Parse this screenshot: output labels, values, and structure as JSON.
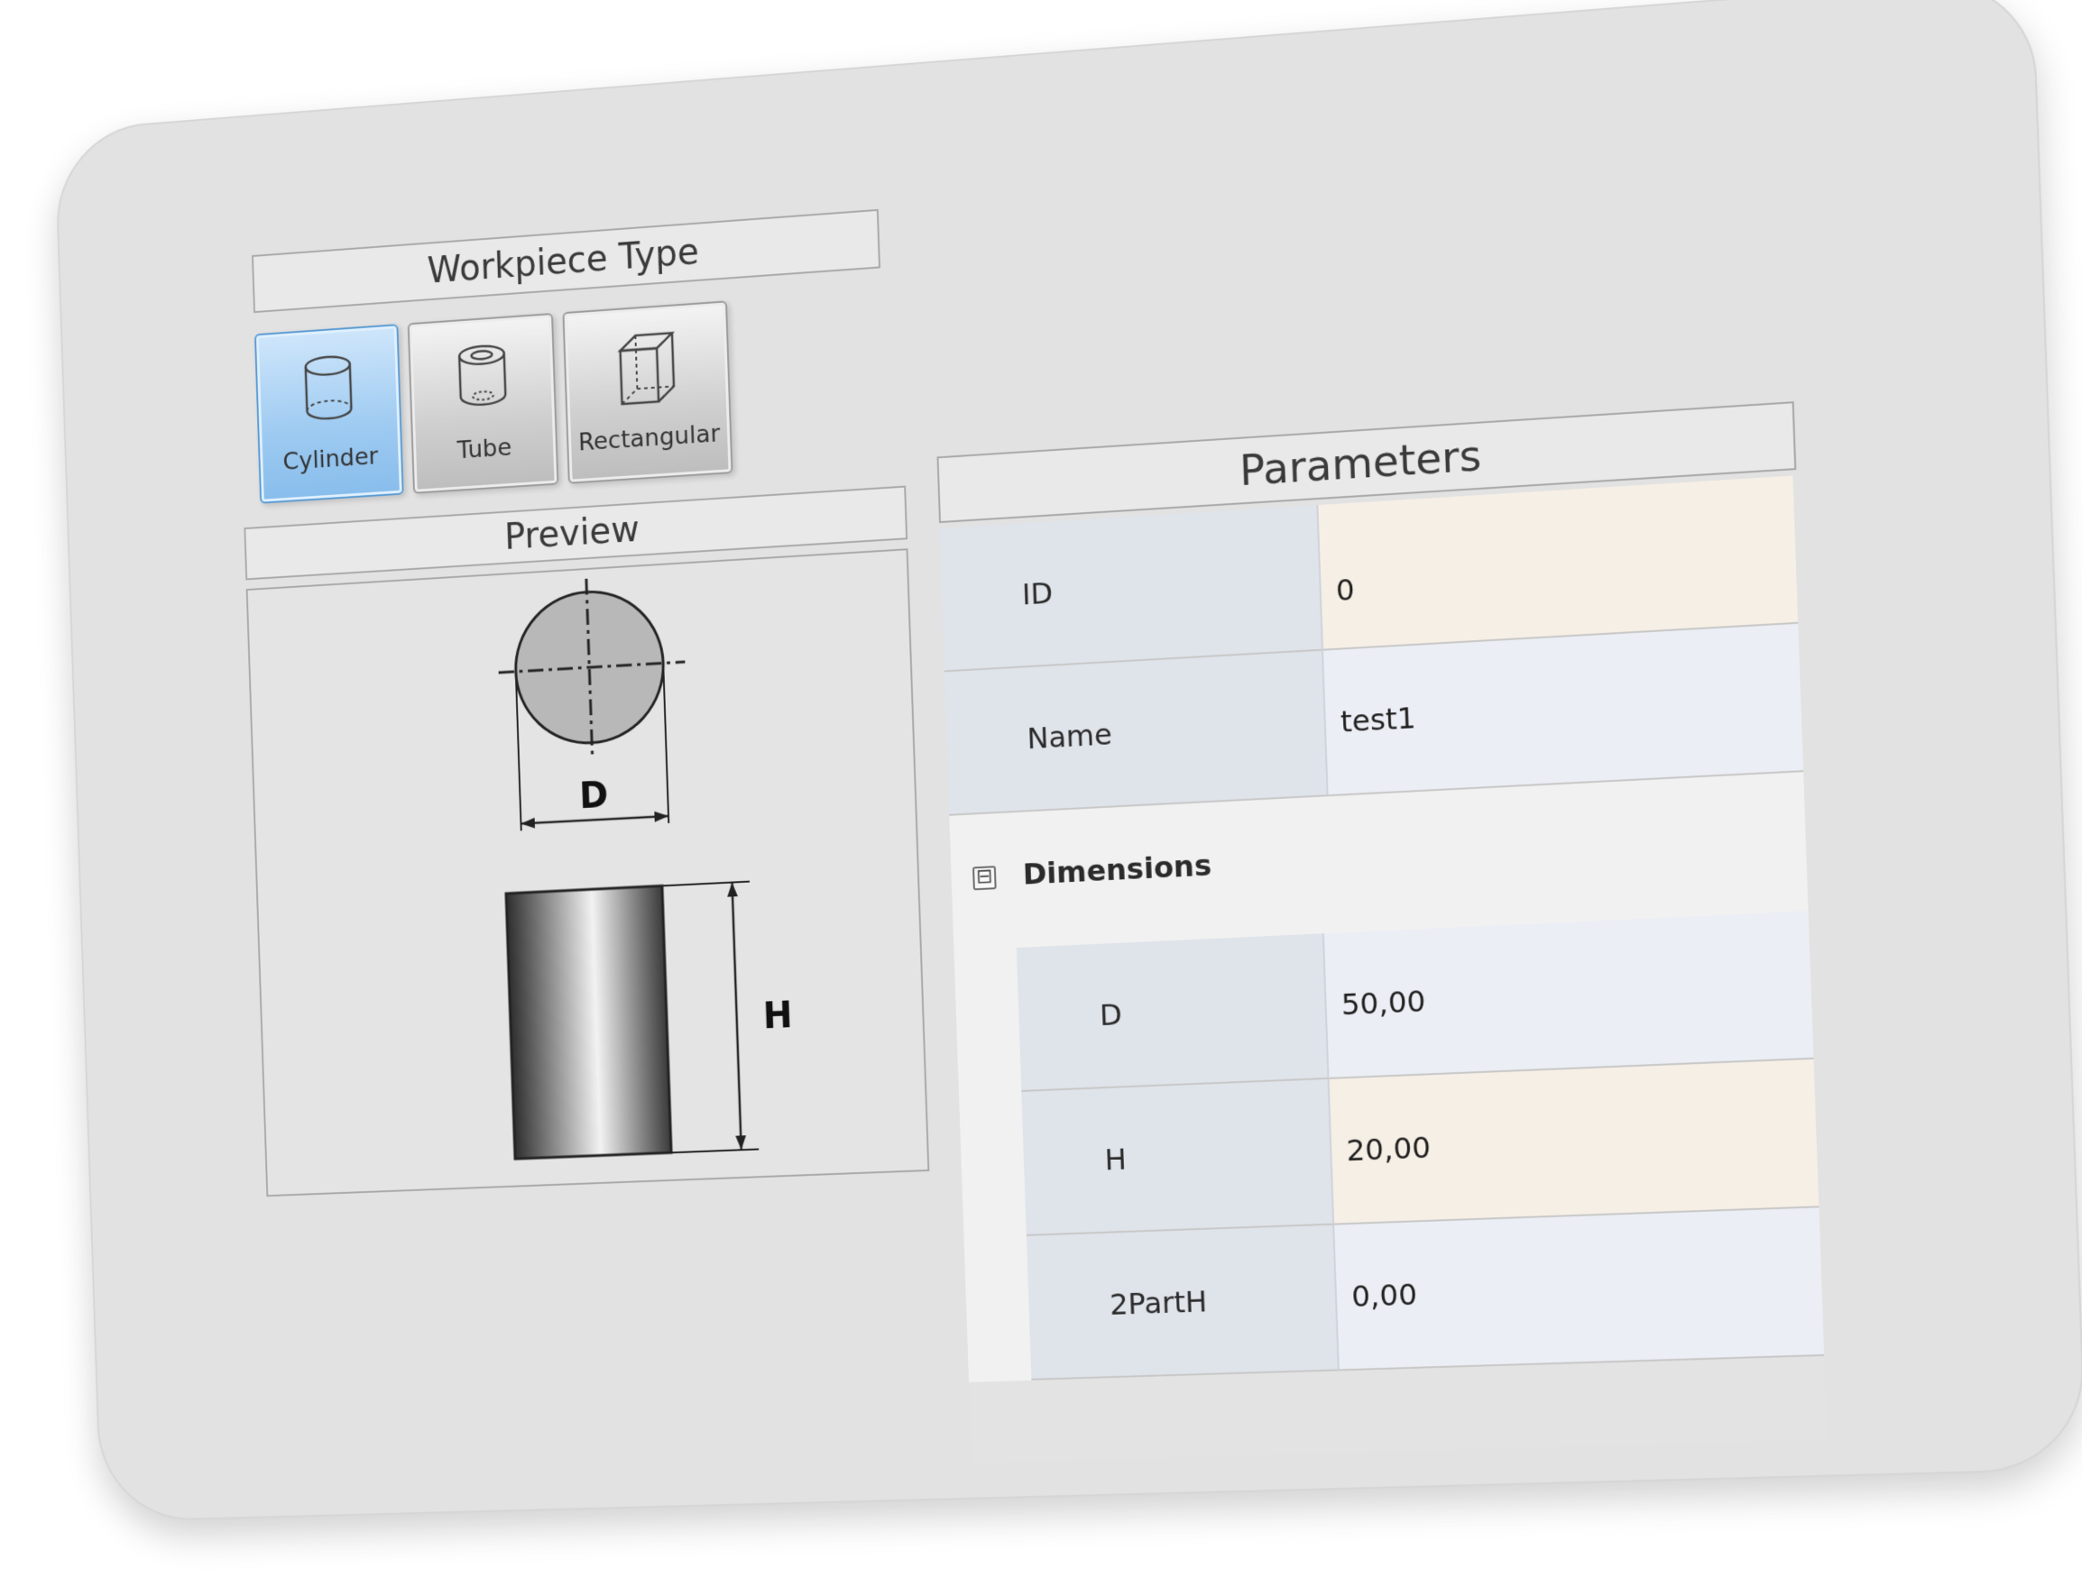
{
  "workpiece_type": {
    "title": "Workpiece Type",
    "buttons": [
      {
        "label": "Cylinder",
        "icon": "cylinder-icon",
        "selected": true
      },
      {
        "label": "Tube",
        "icon": "tube-icon",
        "selected": false
      },
      {
        "label": "Rectangular",
        "icon": "box-icon",
        "selected": false
      }
    ]
  },
  "preview": {
    "title": "Preview",
    "dimension_d": "D",
    "dimension_h": "H"
  },
  "parameters": {
    "title": "Parameters",
    "id": {
      "label": "ID",
      "value": "0"
    },
    "name": {
      "label": "Name",
      "value": "test1"
    },
    "dimensions": {
      "label": "Dimensions",
      "toggle": "⊟",
      "rows": [
        {
          "label": "D",
          "value": "50,00"
        },
        {
          "label": "H",
          "value": "20,00"
        },
        {
          "label": "2PartH",
          "value": "0,00"
        }
      ]
    }
  },
  "colors": {
    "selected_button": "#9dcaf1",
    "highlight_cell": "#f6efe5",
    "panel_background": "#e2e2e2"
  }
}
